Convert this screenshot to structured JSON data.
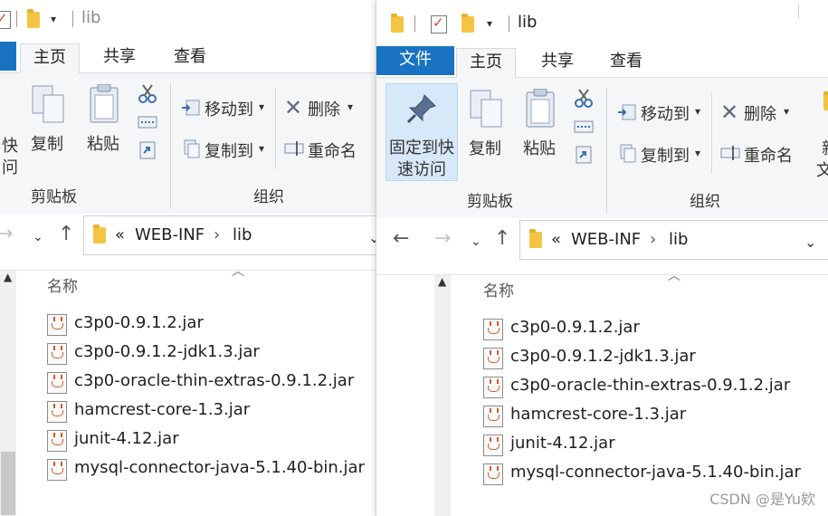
{
  "left_window": {
    "title": "lib",
    "tabs": {
      "home": "主页",
      "share": "共享",
      "view": "查看"
    },
    "ribbon": {
      "pin_partial_1": "快",
      "pin_partial_2": "问",
      "copy": "复制",
      "paste": "粘贴",
      "move_to": "移动到",
      "copy_to": "复制到",
      "delete": "删除",
      "rename": "重命名",
      "group_clipboard": "剪贴板",
      "group_organize": "组织"
    },
    "address": {
      "crumb_prefix": "«",
      "crumb1": "WEB-INF",
      "crumb2": "lib"
    },
    "column_name": "名称",
    "files": [
      "c3p0-0.9.1.2.jar",
      "c3p0-0.9.1.2-jdk1.3.jar",
      "c3p0-oracle-thin-extras-0.9.1.2.jar",
      "hamcrest-core-1.3.jar",
      "junit-4.12.jar",
      "mysql-connector-java-5.1.40-bin.jar"
    ]
  },
  "right_window": {
    "title": "lib",
    "tabs": {
      "file": "文件",
      "home": "主页",
      "share": "共享",
      "view": "查看"
    },
    "ribbon": {
      "pin_line1": "固定到快",
      "pin_line2": "速访问",
      "copy": "复制",
      "paste": "粘贴",
      "move_to": "移动到",
      "copy_to": "复制到",
      "delete": "删除",
      "rename": "重命名",
      "new_partial_1": "新",
      "new_partial_2": "文",
      "group_clipboard": "剪贴板",
      "group_organize": "组织"
    },
    "address": {
      "crumb_prefix": "«",
      "crumb1": "WEB-INF",
      "crumb2": "lib"
    },
    "column_name": "名称",
    "files": [
      "c3p0-0.9.1.2.jar",
      "c3p0-0.9.1.2-jdk1.3.jar",
      "c3p0-oracle-thin-extras-0.9.1.2.jar",
      "hamcrest-core-1.3.jar",
      "junit-4.12.jar",
      "mysql-connector-java-5.1.40-bin.jar"
    ]
  },
  "watermark": "CSDN @是Yu欸",
  "colors": {
    "file_tab": "#1a73c2",
    "ribbon_bg": "#f5f6f7",
    "pin_highlight": "#d7e8f9"
  }
}
